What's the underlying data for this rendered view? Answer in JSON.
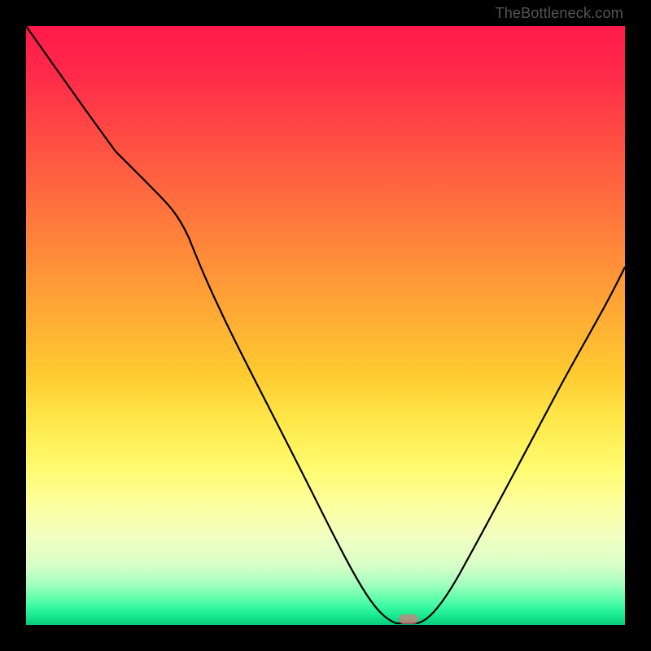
{
  "watermark": "TheBottleneck.com",
  "colors": {
    "top": "#ff1a4b",
    "mid": "#ffe84a",
    "bottom": "#08cc78",
    "curve": "#000000",
    "marker": "#d77b7b",
    "background": "#000000"
  },
  "chart_data": {
    "type": "line",
    "title": "",
    "xlabel": "",
    "ylabel": "",
    "xlim": [
      0,
      100
    ],
    "ylim": [
      0,
      100
    ],
    "x": [
      0,
      5,
      10,
      15,
      20,
      25,
      30,
      35,
      40,
      45,
      50,
      55,
      60,
      62,
      65,
      70,
      75,
      80,
      85,
      90,
      95,
      100
    ],
    "values": [
      100,
      93,
      86,
      79,
      74,
      70,
      62,
      53,
      44,
      35,
      25,
      15,
      3,
      0,
      0,
      3,
      11,
      21,
      32,
      43,
      52,
      60
    ],
    "marker": {
      "x": 64,
      "y": 0
    }
  }
}
